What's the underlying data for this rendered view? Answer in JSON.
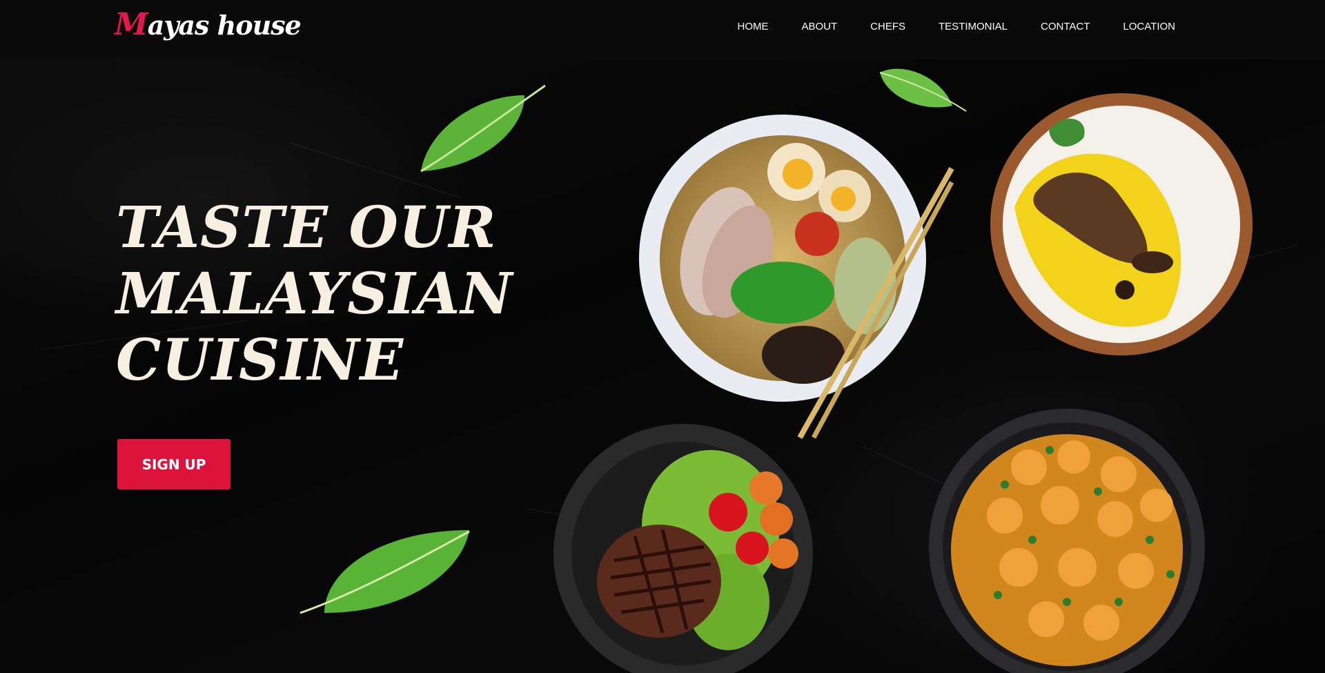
{
  "brand": {
    "initial": "M",
    "rest": "ayas house",
    "accent_color": "#e0194a"
  },
  "nav": {
    "items": [
      {
        "label": "HOME"
      },
      {
        "label": "ABOUT"
      },
      {
        "label": "CHEFS"
      },
      {
        "label": "TESTIMONIAL"
      },
      {
        "label": "CONTACT"
      },
      {
        "label": "LOCATION"
      }
    ]
  },
  "hero": {
    "title_lines": [
      "TASTE OUR",
      "MALAYSIAN",
      "CUISINE"
    ],
    "cta_label": "SIGN UP",
    "cta_color": "#dc143c"
  },
  "images": {
    "ramen": "ramen-bowl-image",
    "biryani": "chicken-biryani-image",
    "steak": "steak-plate-image",
    "curry": "prawn-curry-image",
    "leaf": "banana-leaf-image"
  }
}
